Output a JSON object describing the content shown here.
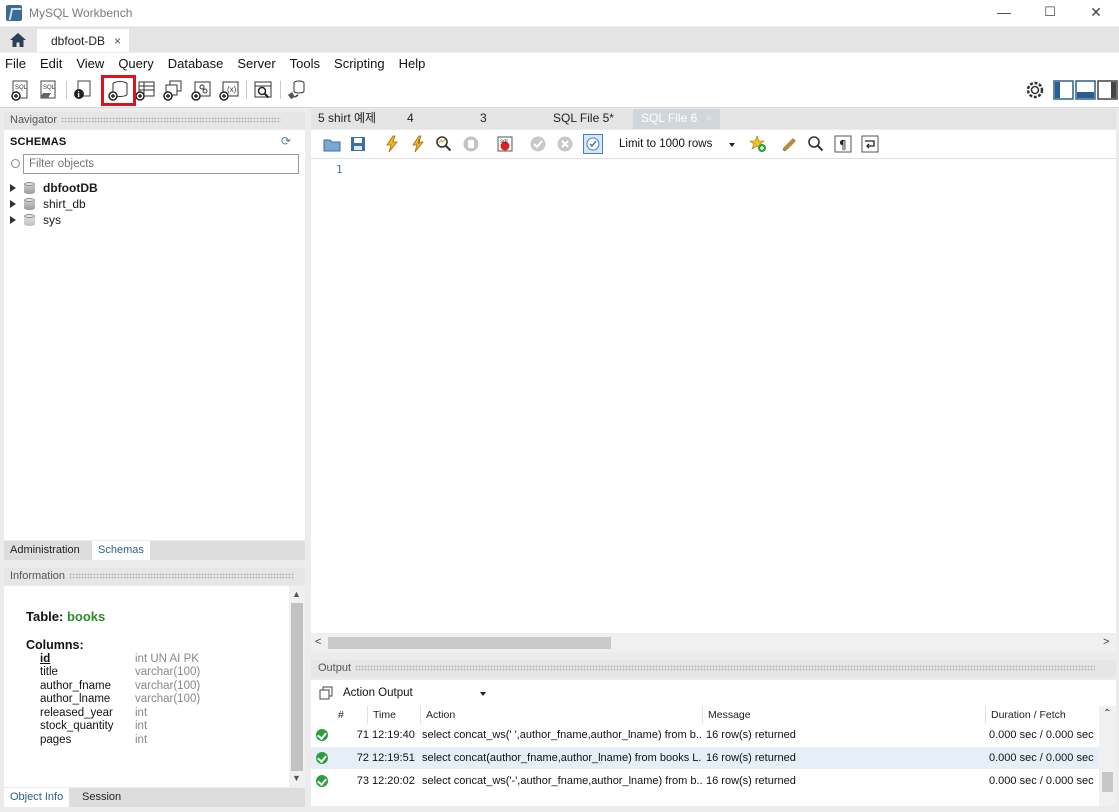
{
  "window": {
    "title": "MySQL Workbench",
    "minimize": "—",
    "maximize": "☐",
    "close": "✕"
  },
  "tabs": {
    "connection_tab": "dbfoot-DB",
    "close": "×"
  },
  "menu": [
    "File",
    "Edit",
    "View",
    "Query",
    "Database",
    "Server",
    "Tools",
    "Scripting",
    "Help"
  ],
  "navigator": {
    "header": "Navigator",
    "schemas_label": "SCHEMAS",
    "filter_placeholder": "Filter objects",
    "schemas": [
      {
        "name": "dbfootDB",
        "bold": true
      },
      {
        "name": "shirt_db",
        "bold": false
      },
      {
        "name": "sys",
        "bold": false
      }
    ],
    "tabs": [
      "Administration",
      "Schemas"
    ],
    "active_tab": "Schemas"
  },
  "information": {
    "header": "Information",
    "table_label": "Table:",
    "table_name": "books",
    "columns_label": "Columns:",
    "columns": [
      {
        "name": "id",
        "type": "int UN AI PK"
      },
      {
        "name": "title",
        "type": "varchar(100)"
      },
      {
        "name": "author_fname",
        "type": "varchar(100)"
      },
      {
        "name": "author_lname",
        "type": "varchar(100)"
      },
      {
        "name": "released_year",
        "type": "int"
      },
      {
        "name": "stock_quantity",
        "type": "int"
      },
      {
        "name": "pages",
        "type": "int"
      }
    ],
    "tabs": [
      "Object Info",
      "Session"
    ],
    "active_tab": "Object Info"
  },
  "editor": {
    "tabs": [
      "5 shirt 예제",
      "4",
      "3",
      "SQL File 5*",
      "SQL File 6"
    ],
    "active_tab": "SQL File 6",
    "limit": "Limit to 1000 rows",
    "line_number": "1"
  },
  "output": {
    "header": "Output",
    "selector": "Action Output",
    "columns": [
      "#",
      "Time",
      "Action",
      "Message",
      "Duration / Fetch"
    ],
    "rows": [
      {
        "num": "71",
        "time": "12:19:40",
        "action": "select concat_ws(' ',author_fname,author_lname) from b...",
        "message": "16 row(s) returned",
        "duration": "0.000 sec / 0.000 sec"
      },
      {
        "num": "72",
        "time": "12:19:51",
        "action": "select concat(author_fname,author_lname) from books L...",
        "message": "16 row(s) returned",
        "duration": "0.000 sec / 0.000 sec"
      },
      {
        "num": "73",
        "time": "12:20:02",
        "action": "select concat_ws('-',author_fname,author_lname) from b...",
        "message": "16 row(s) returned",
        "duration": "0.000 sec / 0.000 sec"
      }
    ]
  },
  "colors": {
    "highlight_box": "#e0121b",
    "table_name": "#2e8b2e",
    "line_number": "#3c77a8",
    "success": "#2e9e3c"
  }
}
